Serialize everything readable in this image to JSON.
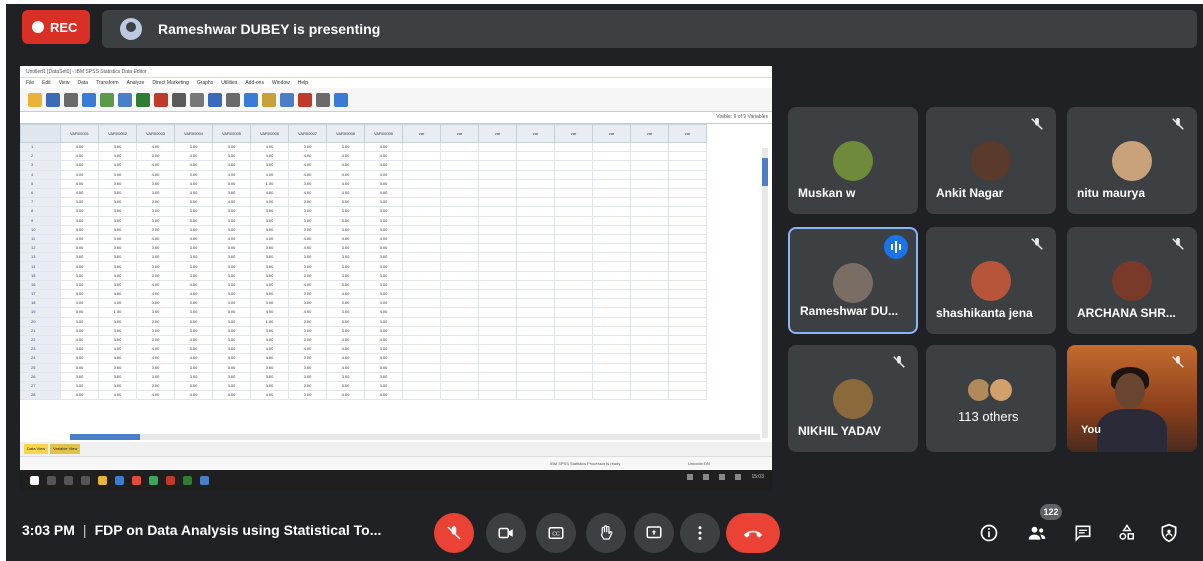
{
  "recording": {
    "label": "REC"
  },
  "presenter": {
    "text": "Rameshwar DUBEY is presenting"
  },
  "shared_screen": {
    "window_title": "Untitled1 [DataSet0] - IBM SPSS Statistics Data Editor",
    "menu": [
      "File",
      "Edit",
      "View",
      "Data",
      "Transform",
      "Analyze",
      "Direct Marketing",
      "Graphs",
      "Utilities",
      "Add-ons",
      "Window",
      "Help"
    ],
    "visible_label": "Visible: 9 of 9 Variables",
    "columns": [
      "VAR00001",
      "VAR00002",
      "VAR00003",
      "VAR00004",
      "VAR00005",
      "VAR00006",
      "VAR00007",
      "VAR00008",
      "VAR00009",
      "var",
      "var",
      "var",
      "var",
      "var",
      "var",
      "var",
      "var"
    ],
    "rows": [
      [
        "4.00",
        "3.00",
        "4.00",
        "3.00",
        "3.00",
        "4.00",
        "3.00",
        "3.00",
        "4.00"
      ],
      [
        "4.00",
        "4.00",
        "3.00",
        "4.00",
        "3.00",
        "4.00",
        "4.00",
        "4.00",
        "4.00"
      ],
      [
        "4.00",
        "4.00",
        "4.00",
        "4.00",
        "4.00",
        "3.00",
        "4.00",
        "4.00",
        "4.00"
      ],
      [
        "3.00",
        "3.00",
        "4.00",
        "3.00",
        "4.00",
        "4.00",
        "4.00",
        "4.00",
        "3.00"
      ],
      [
        "4.00",
        "3.00",
        "3.00",
        "4.00",
        "3.00",
        "1.00",
        "3.00",
        "4.00",
        "3.00"
      ],
      [
        "4.00",
        "3.00",
        "3.00",
        "4.00",
        "3.00",
        "4.00",
        "4.00",
        "4.00",
        "4.00"
      ],
      [
        "3.00",
        "3.00",
        "3.00",
        "3.00",
        "4.00",
        "4.00",
        "3.00",
        "3.00",
        "3.00"
      ],
      [
        "3.00",
        "3.00",
        "3.00",
        "3.00",
        "3.00",
        "3.00",
        "3.00",
        "3.00",
        "3.00"
      ],
      [
        "4.00",
        "3.00",
        "3.00",
        "3.00",
        "3.00",
        "3.00",
        "3.00",
        "3.00",
        "3.00"
      ],
      [
        "4.00",
        "3.00",
        "3.00",
        "3.00",
        "3.00",
        "3.00",
        "3.00",
        "3.00",
        "3.00"
      ],
      [
        "4.00",
        "3.00",
        "4.00",
        "4.00",
        "4.00",
        "4.00",
        "4.00",
        "4.00",
        "4.00"
      ],
      [
        "3.00",
        "3.00",
        "3.00",
        "3.00",
        "3.00",
        "3.00",
        "4.00",
        "3.00",
        "3.00"
      ],
      [
        "3.00",
        "3.00",
        "3.00",
        "3.00",
        "3.00",
        "3.00",
        "3.00",
        "3.00",
        "3.00"
      ],
      [
        "4.00",
        "3.00",
        "3.00",
        "3.00",
        "3.00",
        "3.00",
        "3.00",
        "3.00",
        "3.00"
      ],
      [
        "3.00",
        "4.00",
        "3.00",
        "3.00",
        "3.00",
        "3.00",
        "3.00",
        "3.00",
        "3.00"
      ],
      [
        "3.00",
        "3.00",
        "4.00",
        "4.00",
        "3.00",
        "4.00",
        "4.00",
        "3.00",
        "3.00"
      ],
      [
        "4.00",
        "4.00",
        "4.00",
        "4.00",
        "3.00",
        "3.00",
        "3.00",
        "4.00",
        "3.00"
      ],
      [
        "3.00",
        "4.00",
        "3.00",
        "3.00",
        "3.00",
        "3.00",
        "3.00",
        "3.00",
        "3.00"
      ],
      [
        "3.00",
        "1.00",
        "3.00",
        "3.00",
        "3.00",
        "4.00",
        "4.00",
        "3.00",
        "4.00"
      ],
      [
        "3.00",
        "3.00",
        "3.00",
        "3.00",
        "3.00",
        "1.00",
        "3.00",
        "3.00",
        "3.00"
      ],
      [
        "3.00",
        "3.00",
        "3.00",
        "3.00",
        "3.00",
        "3.00",
        "3.00",
        "3.00",
        "3.00"
      ],
      [
        "4.00",
        "3.00",
        "3.00",
        "4.00",
        "3.00",
        "4.00",
        "3.00",
        "4.00",
        "4.00"
      ],
      [
        "4.00",
        "4.00",
        "4.00",
        "3.00",
        "4.00",
        "4.00",
        "4.00",
        "4.00",
        "3.00"
      ],
      [
        "4.00",
        "4.00",
        "4.00",
        "4.00",
        "4.00",
        "4.00",
        "3.00",
        "4.00",
        "4.00"
      ],
      [
        "3.00",
        "3.00",
        "3.00",
        "3.00",
        "3.00",
        "3.00",
        "3.00",
        "4.00",
        "3.00"
      ],
      [
        "3.00",
        "3.00",
        "3.00",
        "3.00",
        "3.00",
        "3.00",
        "3.00",
        "3.00",
        "3.00"
      ],
      [
        "3.00",
        "3.00",
        "3.00",
        "3.00",
        "3.00",
        "3.00",
        "3.00",
        "3.00",
        "3.00"
      ],
      [
        "4.00",
        "4.00",
        "4.00",
        "4.00",
        "4.00",
        "4.00",
        "3.00",
        "4.00",
        "4.00"
      ]
    ],
    "tabs": {
      "data_view": "Data View",
      "variable_view": "Variable View"
    },
    "status_text": "IBM SPSS Statistics Processor is ready",
    "encoding_text": "Unicode:ON",
    "clock_text": "15:03"
  },
  "participants": [
    {
      "name": "Muskan w",
      "muted": false,
      "avatar_color": "#6e8a3a"
    },
    {
      "name": "Ankit Nagar",
      "muted": true,
      "avatar_color": "#5a3a2a"
    },
    {
      "name": "nitu maurya",
      "muted": true,
      "avatar_color": "#c9a27c"
    },
    {
      "name": "Rameshwar DU...",
      "muted": false,
      "speaking": true,
      "avatar_color": "#7a6e64"
    },
    {
      "name": "shashikanta jena",
      "muted": true,
      "avatar_color": "#b6553a"
    },
    {
      "name": "ARCHANA SHR...",
      "muted": true,
      "avatar_color": "#7a3a2a"
    },
    {
      "name": "NIKHIL YADAV",
      "muted": true,
      "avatar_color": "#8a6a3a"
    },
    {
      "name": "113 others",
      "muted": false
    },
    {
      "name": "You",
      "muted": true
    }
  ],
  "bottom": {
    "time": "3:03 PM",
    "separator": "|",
    "meeting_title": "FDP on Data Analysis using Statistical To..."
  },
  "controls": {
    "mic": "mic-off-icon",
    "camera": "camera-icon",
    "captions": "captions-icon",
    "raise_hand": "hand-icon",
    "present": "present-screen-icon",
    "more": "more-options-icon",
    "end_call": "end-call-icon"
  },
  "right_controls": {
    "people_count": "122"
  },
  "colors": {
    "background": "#202124",
    "tile": "#3c4043",
    "red": "#ea4335",
    "accent_blue": "#8ab4f8"
  }
}
